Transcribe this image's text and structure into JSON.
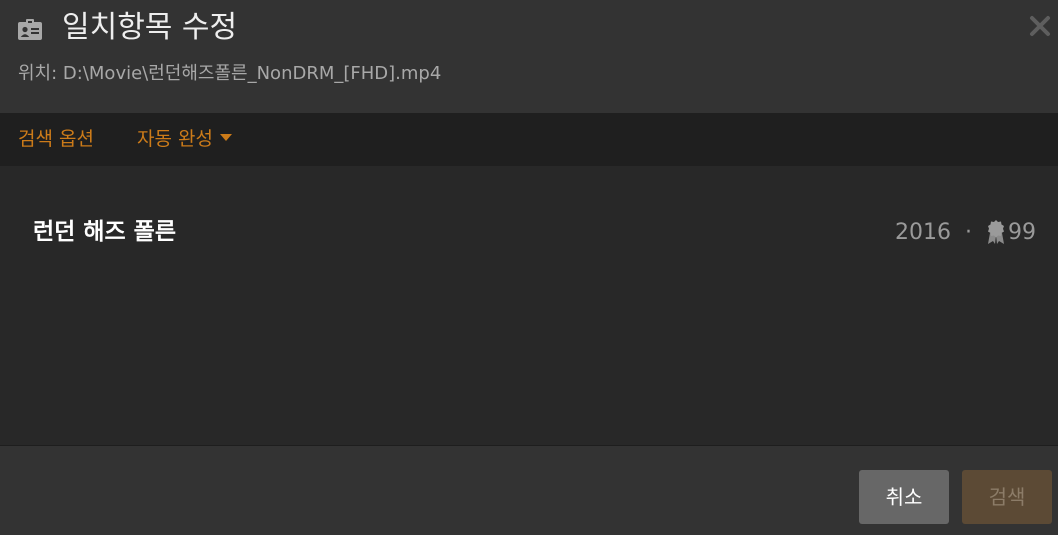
{
  "header": {
    "title": "일치항목 수정",
    "location": "위치: D:\\Movie\\런던해즈폴른_NonDRM_[FHD].mp4",
    "icon": "id-card-icon",
    "close_icon": "close-icon"
  },
  "tabs": {
    "search_options": "검색 옵션",
    "auto_complete": "자동 완성"
  },
  "results": [
    {
      "title": "런던 해즈 폴른",
      "year": "2016",
      "separator": "·",
      "score": "99",
      "score_icon": "award-icon"
    }
  ],
  "footer": {
    "cancel_label": "취소",
    "search_label": "검색"
  },
  "colors": {
    "accent": "#cc7b19",
    "background": "#282828",
    "header_bg": "#333333",
    "tabbar_bg": "#1f1f1f",
    "cancel_bg": "#676767",
    "search_bg": "#5c4a35"
  }
}
